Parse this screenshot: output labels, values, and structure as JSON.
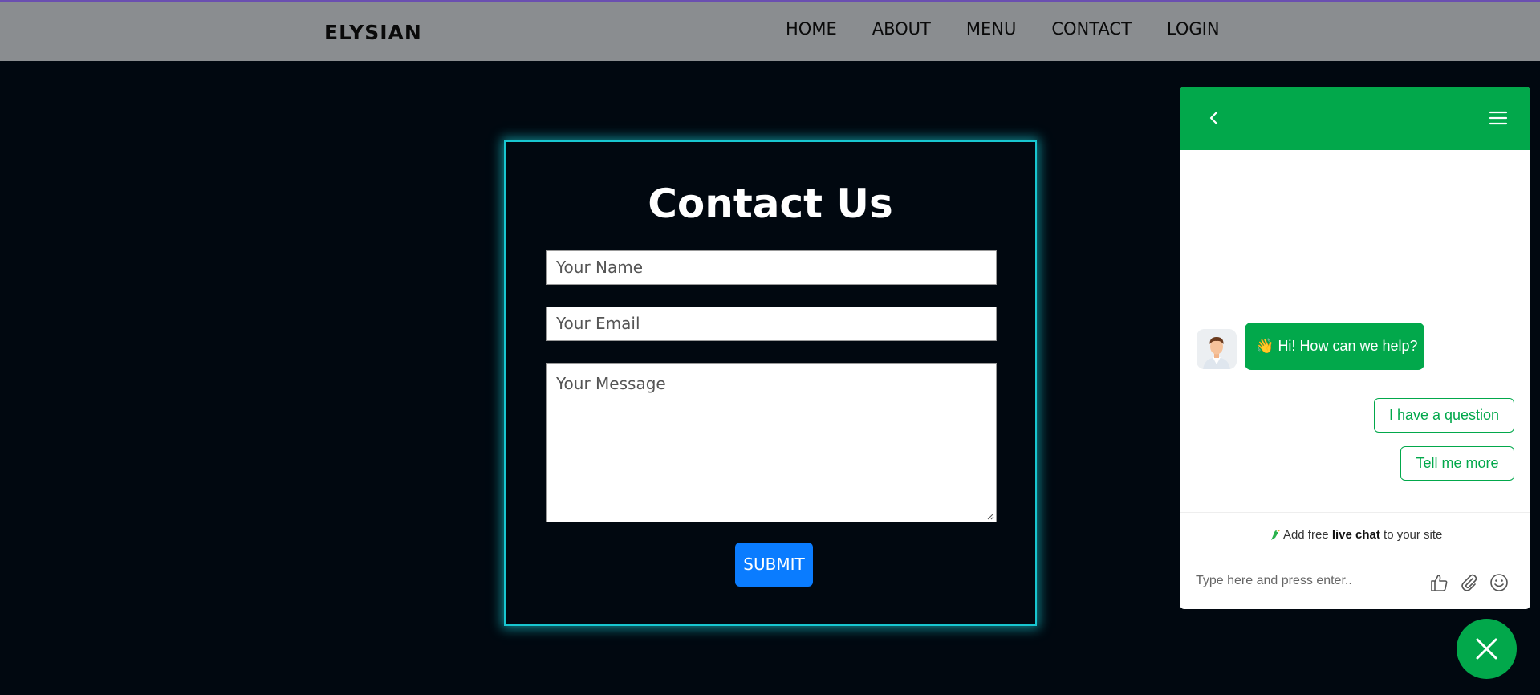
{
  "navbar": {
    "brand": "ELYSIAN",
    "links": [
      "HOME",
      "ABOUT",
      "MENU",
      "CONTACT",
      "LOGIN"
    ]
  },
  "contact": {
    "title": "Contact Us",
    "name_placeholder": "Your Name",
    "email_placeholder": "Your Email",
    "message_placeholder": "Your Message",
    "submit_label": "SUBMIT"
  },
  "chat": {
    "greeting_emoji": "👋",
    "greeting": "Hi! How can we help?",
    "options": [
      "I have a question",
      "Tell me more"
    ],
    "powered_prefix": "Add free",
    "powered_bold": "live chat",
    "powered_suffix": "to your site",
    "input_placeholder": "Type here and press enter..",
    "icons": [
      "back-icon",
      "menu-icon",
      "thumbs-up-icon",
      "paperclip-icon",
      "smiley-icon",
      "close-icon"
    ]
  },
  "colors": {
    "background": "#010810",
    "navbar": "#8a8d90",
    "glow": "#18c6d0",
    "submit": "#0a7cff",
    "chat_green": "#02a84b"
  }
}
